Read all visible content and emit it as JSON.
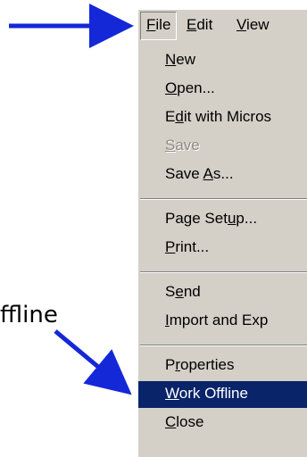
{
  "menubar": {
    "file": {
      "mnemonic": "F",
      "rest": "ile"
    },
    "edit": {
      "mnemonic": "E",
      "rest": "dit"
    },
    "view": {
      "mnemonic": "V",
      "rest": "iew"
    }
  },
  "menu": {
    "new": {
      "mnemonic": "N",
      "rest": "ew"
    },
    "open": {
      "mnemonic": "O",
      "rest": "pen..."
    },
    "edit_with": {
      "pre": "E",
      "mnemonic": "d",
      "rest": "it with Micros"
    },
    "save": {
      "mnemonic": "S",
      "rest": "ave"
    },
    "save_as": {
      "pre": "Save ",
      "mnemonic": "A",
      "rest": "s..."
    },
    "page_setup": {
      "pre": "Page Set",
      "mnemonic": "u",
      "rest": "p..."
    },
    "print": {
      "mnemonic": "P",
      "rest": "rint..."
    },
    "send": {
      "pre": "S",
      "mnemonic": "e",
      "rest": "nd"
    },
    "import_export": {
      "mnemonic": "I",
      "rest": "mport and Exp"
    },
    "properties": {
      "pre": "P",
      "mnemonic": "r",
      "rest": "operties"
    },
    "work_offline": {
      "mnemonic": "W",
      "rest": "ork Offline"
    },
    "close": {
      "mnemonic": "C",
      "rest": "lose"
    }
  },
  "callout_label": "ffline",
  "colors": {
    "menu_bg": "#d4d0c8",
    "highlight": "#0a246a",
    "arrow": "#1428d8"
  }
}
